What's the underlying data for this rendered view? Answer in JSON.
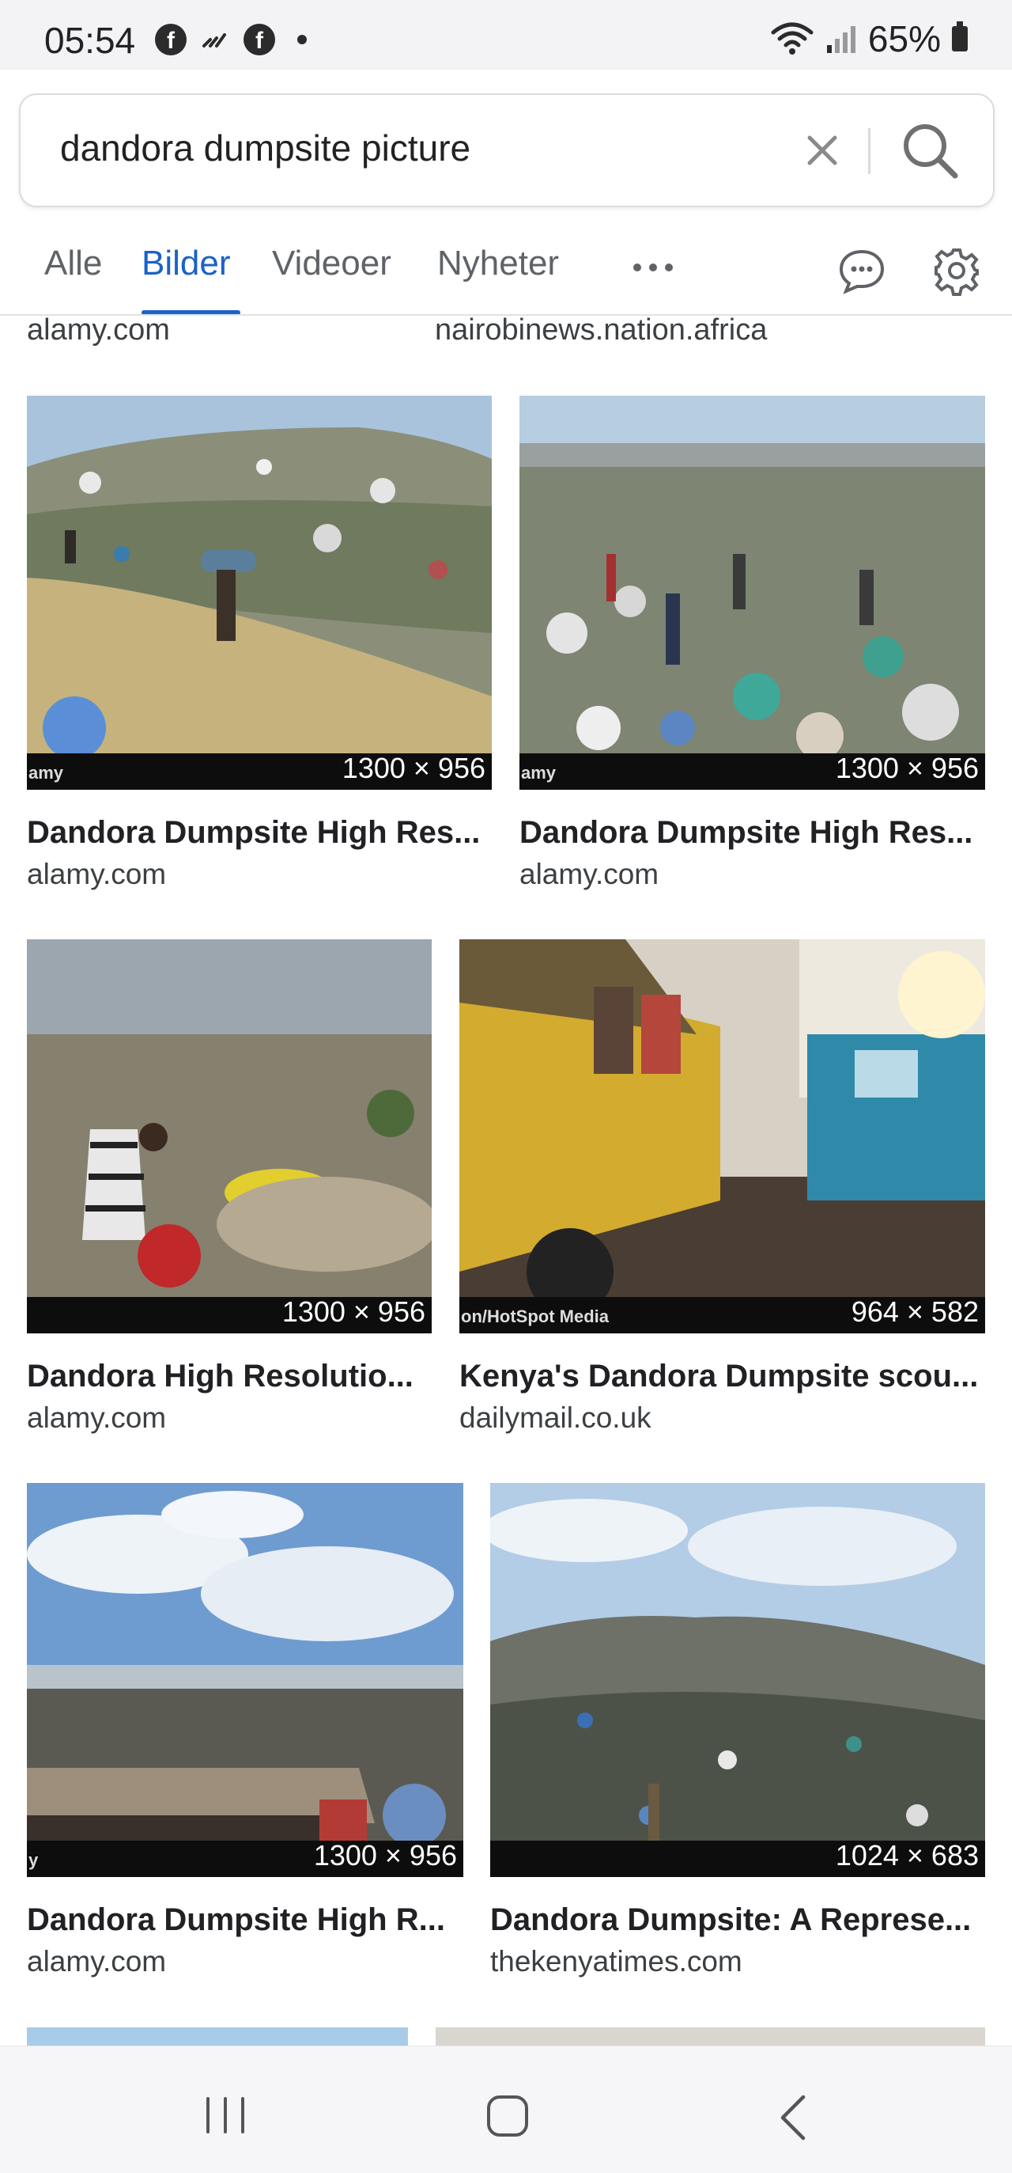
{
  "status": {
    "time": "05:54",
    "battery": "65%"
  },
  "search": {
    "query": "dandora dumpsite picture"
  },
  "tabs": [
    {
      "label": "Alle"
    },
    {
      "label": "Bilder"
    },
    {
      "label": "Videoer"
    },
    {
      "label": "Nyheter"
    }
  ],
  "top_sources": [
    "alamy.com",
    "nairobinews.nation.africa"
  ],
  "results": [
    {
      "title": "Dandora Dumpsite High Res...",
      "source": "alamy.com",
      "dims": "1300 × 956",
      "watermark": "amy"
    },
    {
      "title": "Dandora Dumpsite High Res...",
      "source": "alamy.com",
      "dims": "1300 × 956",
      "watermark": "amy"
    },
    {
      "title": "Dandora High Resolutio...",
      "source": "alamy.com",
      "dims": "1300 × 956",
      "watermark": ""
    },
    {
      "title": "Kenya's Dandora Dumpsite scou...",
      "source": "dailymail.co.uk",
      "dims": "964 × 582",
      "watermark": "on/HotSpot Media"
    },
    {
      "title": "Dandora Dumpsite High R...",
      "source": "alamy.com",
      "dims": "1300 × 956",
      "watermark": "y"
    },
    {
      "title": "Dandora Dumpsite: A Represe...",
      "source": "thekenyatimes.com",
      "dims": "1024 × 683",
      "watermark": ""
    }
  ],
  "icons": {
    "clear": "close-icon",
    "search": "search-icon",
    "more": "more-horizontal-icon",
    "chat": "chat-bubble-icon",
    "settings": "gear-icon",
    "nav_recents": "recents-icon",
    "nav_home": "home-icon",
    "nav_back": "back-icon"
  },
  "colors": {
    "accent": "#1a62c7",
    "text_muted": "#5f6368"
  }
}
